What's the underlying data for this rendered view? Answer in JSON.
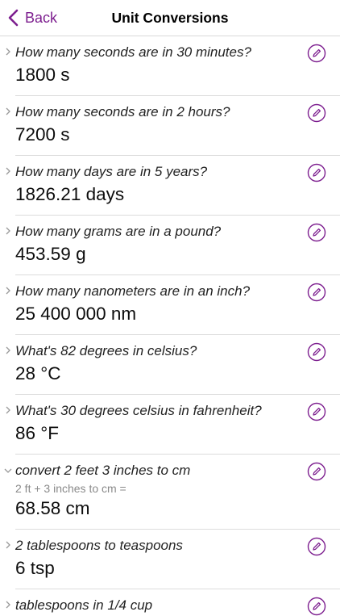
{
  "nav": {
    "back_label": "Back",
    "title": "Unit Conversions"
  },
  "accent_color": "#7d1f8f",
  "rows": [
    {
      "question": "How many seconds are in 30 minutes?",
      "answer": "1800 s",
      "expanded": false
    },
    {
      "question": "How many seconds are in 2 hours?",
      "answer": "7200 s",
      "expanded": false
    },
    {
      "question": "How many days are in 5 years?",
      "answer": "1826.21 days",
      "expanded": false
    },
    {
      "question": "How many grams are in a pound?",
      "answer": "453.59 g",
      "expanded": false
    },
    {
      "question": "How many nanometers are in an inch?",
      "answer": "25 400 000 nm",
      "expanded": false
    },
    {
      "question": "What's 82 degrees in celsius?",
      "answer": "28 °C",
      "expanded": false
    },
    {
      "question": "What's 30 degrees celsius in fahrenheit?",
      "answer": "86 °F",
      "expanded": false
    },
    {
      "question": "convert 2 feet 3 inches to cm",
      "interpretation": "2 ft + 3 inches to cm =",
      "answer": "68.58 cm",
      "expanded": true
    },
    {
      "question": "2 tablespoons to teaspoons",
      "answer": "6 tsp",
      "expanded": false
    },
    {
      "question": "tablespoons in 1/4 cup",
      "answer": "",
      "expanded": false
    }
  ],
  "icons": {
    "back": "chevron-left-icon",
    "collapsed": "chevron-right-icon",
    "expanded": "chevron-down-icon",
    "edit": "pencil-circle-icon"
  }
}
